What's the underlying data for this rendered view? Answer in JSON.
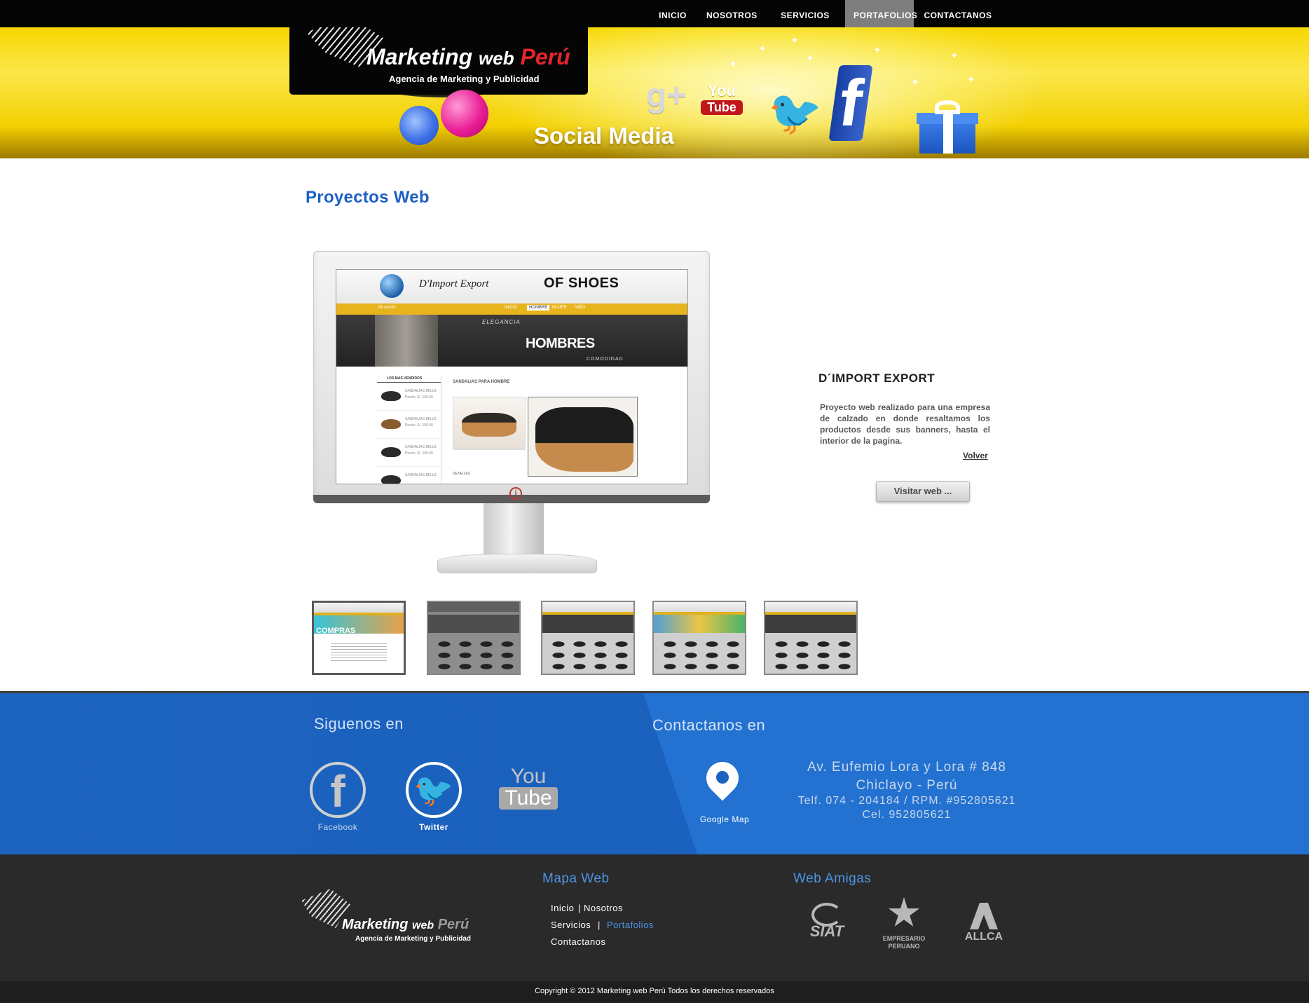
{
  "nav": {
    "items": [
      {
        "label": "INICIO"
      },
      {
        "label": "NOSOTROS"
      },
      {
        "label": "SERVICIOS"
      },
      {
        "label": "PORTAFOLIOS",
        "active": true
      },
      {
        "label": "CONTACTANOS"
      }
    ]
  },
  "banner": {
    "logo": {
      "word1": "Marketing",
      "word2": "web",
      "word3": "Perú",
      "tagline": "Agencia de Marketing y Publicidad"
    },
    "title": "Social Media",
    "youtube": {
      "you": "You",
      "tube": "Tube"
    }
  },
  "main": {
    "heading": "Proyectos Web",
    "screen": {
      "brand": "D'Import Export",
      "shoes": "OF SHOES",
      "nav": [
        "INICIO",
        "HOMBRE",
        "MUJER",
        "NIÑO"
      ],
      "cart": "Mi carrito",
      "hero_title": "HOMBRES",
      "hero_sub1": "ELEGANCIA",
      "hero_sub2": "COMODIDAD",
      "sidebar_title": "LOS MAS VENDIDOS",
      "sidebar_items": [
        {
          "name": "SANDALIAS BELLE",
          "price": "Precio: S/. 150.00"
        },
        {
          "name": "SANDALIAS BELLE",
          "price": "Precio: S/. 150.00"
        },
        {
          "name": "SANDALIAS BELLE",
          "price": "Precio: S/. 150.00"
        },
        {
          "name": "SANDALIAS BELLE",
          "price": ""
        }
      ],
      "content_title": "SANDALIAS PARA HOMBRE",
      "details": "DETALLES"
    },
    "project": {
      "title": "D´IMPORT EXPORT",
      "description": "Proyecto web realizado para una empresa de calzado en donde resaltamos los productos desde sus banners, hasta el interior de la pagina.",
      "back": "Volver",
      "visit": "Visitar web  ..."
    },
    "thumbs": [
      {
        "text": "COMPRAS",
        "active": true
      },
      {
        "text": ""
      },
      {
        "text": ""
      },
      {
        "text": ""
      },
      {
        "text": ""
      }
    ]
  },
  "follow": {
    "heading": "Siguenos en",
    "facebook": "Facebook",
    "twitter": "Twitter",
    "youtube": {
      "you": "You",
      "tube": "Tube"
    }
  },
  "contact": {
    "heading": "Contactanos en",
    "map_label": "Google Map",
    "address_lines": [
      "Av. Eufemio Lora y Lora # 848",
      "Chiclayo - Perú",
      "Telf. 074 - 204184 / RPM. #952805621",
      "Cel. 952805621"
    ]
  },
  "footer": {
    "logo": {
      "word1": "Marketing",
      "word2": "web",
      "word3": "Perú",
      "tagline": "Agencia de Marketing y Publicidad"
    },
    "sitemap_heading": "Mapa Web",
    "sitemap": {
      "inicio": "Inicio",
      "nosotros": "Nosotros",
      "servicios": "Servicios",
      "portafolios": "Portafolios",
      "contactanos": "Contactanos",
      "sep": "|"
    },
    "friends_heading": "Web Amigas",
    "partners": {
      "siat": "SIAT",
      "empresario": "EMPRESARIO PERUANO",
      "allca": "ALLCA"
    },
    "copyright": "Copyright © 2012   Marketing web Perú Todos los derechos reservados"
  },
  "colors": {
    "accent_blue": "#1d5fc4",
    "banner_yellow": "#f7d700",
    "footer_blue": "#1d64bf",
    "footer_dark": "#2a2a2a",
    "logo_red": "#e3262c"
  },
  "icons": [
    "google-plus-icon",
    "youtube-icon",
    "twitter-icon",
    "facebook-icon",
    "gift-icon",
    "map-pin-icon",
    "bird-logo-icon"
  ]
}
